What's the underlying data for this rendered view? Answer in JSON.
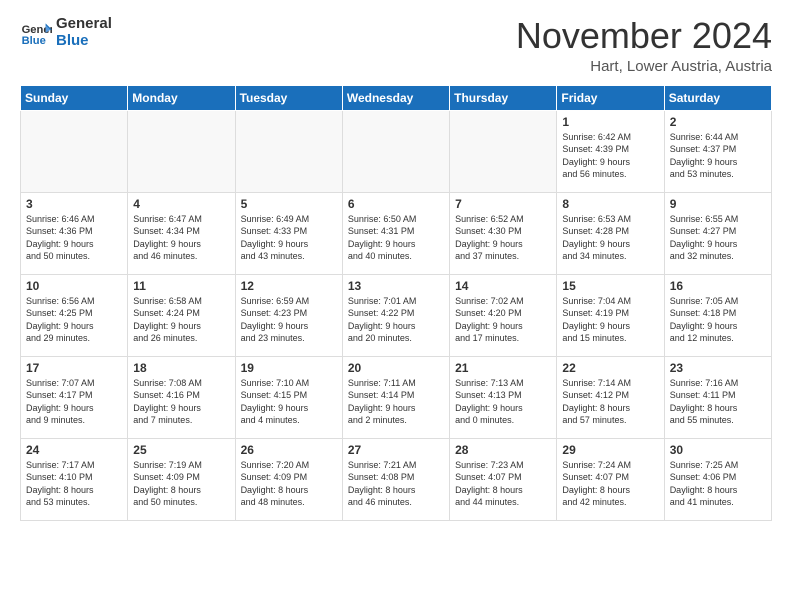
{
  "logo": {
    "line1": "General",
    "line2": "Blue"
  },
  "title": "November 2024",
  "location": "Hart, Lower Austria, Austria",
  "weekdays": [
    "Sunday",
    "Monday",
    "Tuesday",
    "Wednesday",
    "Thursday",
    "Friday",
    "Saturday"
  ],
  "weeks": [
    [
      {
        "day": "",
        "info": ""
      },
      {
        "day": "",
        "info": ""
      },
      {
        "day": "",
        "info": ""
      },
      {
        "day": "",
        "info": ""
      },
      {
        "day": "",
        "info": ""
      },
      {
        "day": "1",
        "info": "Sunrise: 6:42 AM\nSunset: 4:39 PM\nDaylight: 9 hours\nand 56 minutes."
      },
      {
        "day": "2",
        "info": "Sunrise: 6:44 AM\nSunset: 4:37 PM\nDaylight: 9 hours\nand 53 minutes."
      }
    ],
    [
      {
        "day": "3",
        "info": "Sunrise: 6:46 AM\nSunset: 4:36 PM\nDaylight: 9 hours\nand 50 minutes."
      },
      {
        "day": "4",
        "info": "Sunrise: 6:47 AM\nSunset: 4:34 PM\nDaylight: 9 hours\nand 46 minutes."
      },
      {
        "day": "5",
        "info": "Sunrise: 6:49 AM\nSunset: 4:33 PM\nDaylight: 9 hours\nand 43 minutes."
      },
      {
        "day": "6",
        "info": "Sunrise: 6:50 AM\nSunset: 4:31 PM\nDaylight: 9 hours\nand 40 minutes."
      },
      {
        "day": "7",
        "info": "Sunrise: 6:52 AM\nSunset: 4:30 PM\nDaylight: 9 hours\nand 37 minutes."
      },
      {
        "day": "8",
        "info": "Sunrise: 6:53 AM\nSunset: 4:28 PM\nDaylight: 9 hours\nand 34 minutes."
      },
      {
        "day": "9",
        "info": "Sunrise: 6:55 AM\nSunset: 4:27 PM\nDaylight: 9 hours\nand 32 minutes."
      }
    ],
    [
      {
        "day": "10",
        "info": "Sunrise: 6:56 AM\nSunset: 4:25 PM\nDaylight: 9 hours\nand 29 minutes."
      },
      {
        "day": "11",
        "info": "Sunrise: 6:58 AM\nSunset: 4:24 PM\nDaylight: 9 hours\nand 26 minutes."
      },
      {
        "day": "12",
        "info": "Sunrise: 6:59 AM\nSunset: 4:23 PM\nDaylight: 9 hours\nand 23 minutes."
      },
      {
        "day": "13",
        "info": "Sunrise: 7:01 AM\nSunset: 4:22 PM\nDaylight: 9 hours\nand 20 minutes."
      },
      {
        "day": "14",
        "info": "Sunrise: 7:02 AM\nSunset: 4:20 PM\nDaylight: 9 hours\nand 17 minutes."
      },
      {
        "day": "15",
        "info": "Sunrise: 7:04 AM\nSunset: 4:19 PM\nDaylight: 9 hours\nand 15 minutes."
      },
      {
        "day": "16",
        "info": "Sunrise: 7:05 AM\nSunset: 4:18 PM\nDaylight: 9 hours\nand 12 minutes."
      }
    ],
    [
      {
        "day": "17",
        "info": "Sunrise: 7:07 AM\nSunset: 4:17 PM\nDaylight: 9 hours\nand 9 minutes."
      },
      {
        "day": "18",
        "info": "Sunrise: 7:08 AM\nSunset: 4:16 PM\nDaylight: 9 hours\nand 7 minutes."
      },
      {
        "day": "19",
        "info": "Sunrise: 7:10 AM\nSunset: 4:15 PM\nDaylight: 9 hours\nand 4 minutes."
      },
      {
        "day": "20",
        "info": "Sunrise: 7:11 AM\nSunset: 4:14 PM\nDaylight: 9 hours\nand 2 minutes."
      },
      {
        "day": "21",
        "info": "Sunrise: 7:13 AM\nSunset: 4:13 PM\nDaylight: 9 hours\nand 0 minutes."
      },
      {
        "day": "22",
        "info": "Sunrise: 7:14 AM\nSunset: 4:12 PM\nDaylight: 8 hours\nand 57 minutes."
      },
      {
        "day": "23",
        "info": "Sunrise: 7:16 AM\nSunset: 4:11 PM\nDaylight: 8 hours\nand 55 minutes."
      }
    ],
    [
      {
        "day": "24",
        "info": "Sunrise: 7:17 AM\nSunset: 4:10 PM\nDaylight: 8 hours\nand 53 minutes."
      },
      {
        "day": "25",
        "info": "Sunrise: 7:19 AM\nSunset: 4:09 PM\nDaylight: 8 hours\nand 50 minutes."
      },
      {
        "day": "26",
        "info": "Sunrise: 7:20 AM\nSunset: 4:09 PM\nDaylight: 8 hours\nand 48 minutes."
      },
      {
        "day": "27",
        "info": "Sunrise: 7:21 AM\nSunset: 4:08 PM\nDaylight: 8 hours\nand 46 minutes."
      },
      {
        "day": "28",
        "info": "Sunrise: 7:23 AM\nSunset: 4:07 PM\nDaylight: 8 hours\nand 44 minutes."
      },
      {
        "day": "29",
        "info": "Sunrise: 7:24 AM\nSunset: 4:07 PM\nDaylight: 8 hours\nand 42 minutes."
      },
      {
        "day": "30",
        "info": "Sunrise: 7:25 AM\nSunset: 4:06 PM\nDaylight: 8 hours\nand 41 minutes."
      }
    ]
  ]
}
